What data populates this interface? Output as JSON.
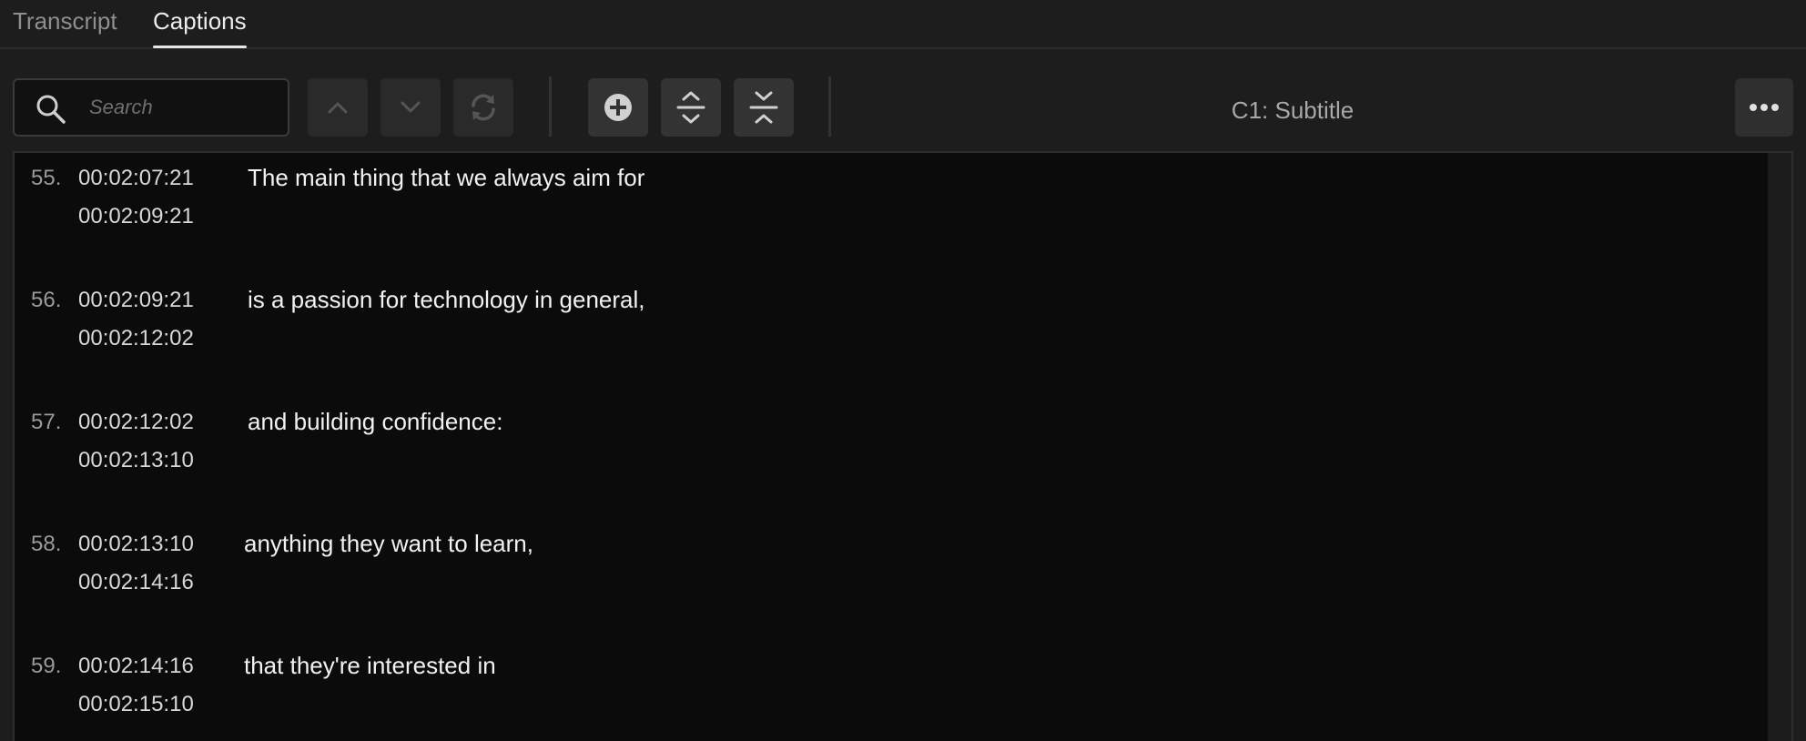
{
  "tabs": [
    {
      "label": "Transcript",
      "active": false
    },
    {
      "label": "Captions",
      "active": true
    }
  ],
  "search": {
    "placeholder": "Search",
    "value": ""
  },
  "toolbar": {
    "buttons": [
      "chevron-up-icon",
      "chevron-down-icon",
      "refresh-icon",
      "add-circle-icon",
      "expand-vertical-icon",
      "collapse-vertical-icon",
      "more-icon"
    ]
  },
  "track": {
    "label": "C1: Subtitle"
  },
  "captions": [
    {
      "num": "55.",
      "in": "00:02:07:21",
      "out": "00:02:09:21",
      "text": "The main thing that we always aim for"
    },
    {
      "num": "56.",
      "in": "00:02:09:21",
      "out": "00:02:12:02",
      "text": "is a passion for technology in general,"
    },
    {
      "num": "57.",
      "in": "00:02:12:02",
      "out": "00:02:13:10",
      "text": "and building confidence:"
    },
    {
      "num": "58.",
      "in": "00:02:13:10",
      "out": "00:02:14:16",
      "text": "anything they want to learn,"
    },
    {
      "num": "59.",
      "in": "00:02:14:16",
      "out": "00:02:15:10",
      "text": "that they're interested in"
    }
  ],
  "colors": {
    "background": "#1d1d1d",
    "list_background": "#0b0b0b",
    "text": "#f2f2f2",
    "muted": "#8f8f8f"
  }
}
